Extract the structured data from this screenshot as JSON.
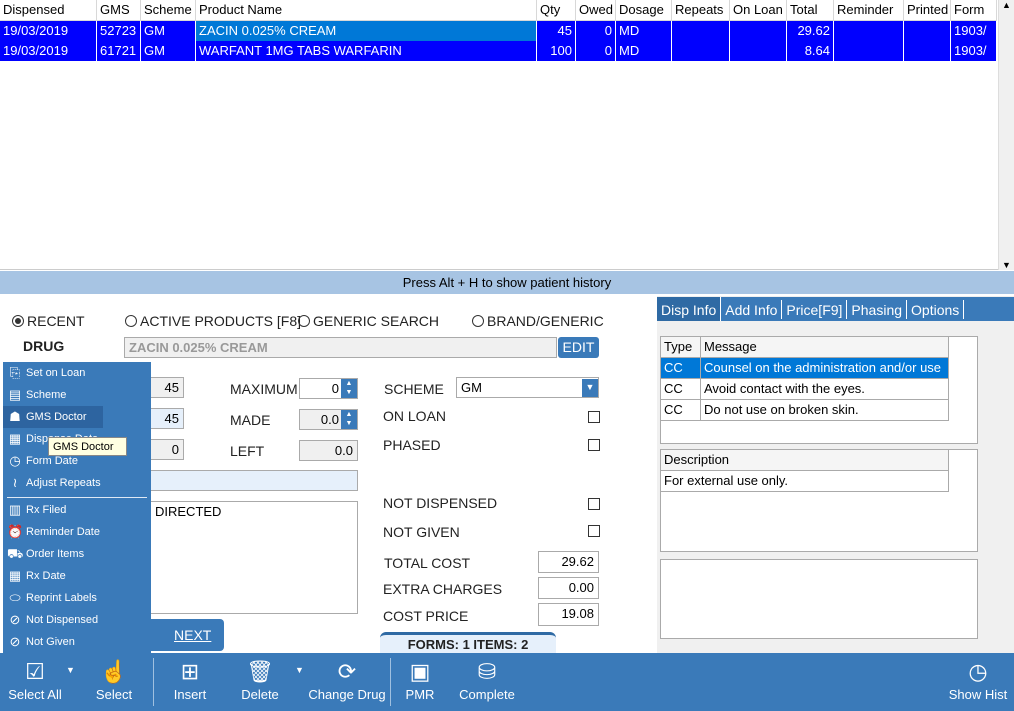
{
  "grid": {
    "columns": [
      "Dispensed",
      "GMS",
      "Scheme",
      "Product Name",
      "Qty",
      "Owed",
      "Dosage",
      "Repeats",
      "On Loan",
      "Total",
      "Reminder",
      "Printed",
      "Form"
    ],
    "rows": [
      [
        "19/03/2019",
        "52723",
        "GM",
        "ZACIN 0.025% CREAM",
        "45",
        "0",
        "MD",
        "",
        "",
        "29.62",
        "",
        "",
        "1903/"
      ],
      [
        "19/03/2019",
        "61721",
        "GM",
        "WARFANT 1MG TABS WARFARIN",
        "100",
        "0",
        "MD",
        "",
        "",
        "8.64",
        "",
        "",
        "1903/"
      ]
    ],
    "selected_row_color": "#0000ff",
    "focused_cell_color": "#0078d7"
  },
  "history_hint": "Press Alt + H to show patient history",
  "search": {
    "options": [
      "RECENT",
      "ACTIVE PRODUCTS [F8]",
      "GENERIC SEARCH",
      "BRAND/GENERIC"
    ],
    "selected": "RECENT"
  },
  "drug": {
    "label": "DRUG",
    "value": "ZACIN 0.025% CREAM",
    "edit": "EDIT"
  },
  "form": {
    "qty1": "45",
    "qty2": "45",
    "qty3": "0",
    "maximum_label": "MAXIMUM",
    "maximum": "0",
    "made_label": "MADE",
    "made": "0.0",
    "left_label": "LEFT",
    "left": "0.0",
    "directions": "DIRECTED",
    "scheme_label": "SCHEME",
    "scheme": "GM",
    "on_loan": "ON LOAN",
    "phased": "PHASED",
    "not_dispensed": "NOT DISPENSED",
    "not_given": "NOT GIVEN",
    "total_cost_label": "TOTAL COST",
    "total_cost": "29.62",
    "extra_label": "EXTRA CHARGES",
    "extra": "0.00",
    "cost_price_label": "COST PRICE",
    "cost_price": "19.08",
    "next": "NEXT",
    "summary": "FORMS: 1  ITEMS: 2"
  },
  "tabs": [
    "Disp Info",
    "Add Info",
    "Price[F9]",
    "Phasing",
    "Options"
  ],
  "messages": {
    "headers": [
      "Type",
      "Message"
    ],
    "rows": [
      [
        "CC",
        "Counsel on the administration and/or use"
      ],
      [
        "CC",
        "Avoid contact with the eyes."
      ],
      [
        "CC",
        "Do not use on broken skin."
      ]
    ]
  },
  "description": {
    "header": "Description",
    "rows": [
      "For external use only."
    ]
  },
  "menu": {
    "items": [
      {
        "label": "Set on Loan",
        "icon": "loan-icon"
      },
      {
        "label": "Scheme",
        "icon": "document-icon"
      },
      {
        "label": "GMS Doctor",
        "icon": "doctor-icon"
      },
      {
        "label": "Dispense Date",
        "icon": "calendar-icon"
      },
      {
        "label": "Form Date",
        "icon": "calendar-clock-icon"
      },
      {
        "label": "Adjust Repeats",
        "icon": "repeats-icon"
      },
      {
        "label": "Rx Filed",
        "icon": "file-icon"
      },
      {
        "label": "Reminder Date",
        "icon": "alarm-icon"
      },
      {
        "label": "Order Items",
        "icon": "cart-icon"
      },
      {
        "label": "Rx Date",
        "icon": "calendar-icon"
      },
      {
        "label": "Reprint Labels",
        "icon": "pill-icon"
      },
      {
        "label": "Not Dispensed",
        "icon": "no-icon"
      },
      {
        "label": "Not Given",
        "icon": "no-icon"
      }
    ],
    "tooltip": "GMS Doctor"
  },
  "toolbar": [
    "Select All",
    "Select",
    "Insert",
    "Delete",
    "Change Drug",
    "PMR",
    "Complete",
    "Show Hist"
  ],
  "colors": {
    "accent": "#3a7ab9"
  }
}
